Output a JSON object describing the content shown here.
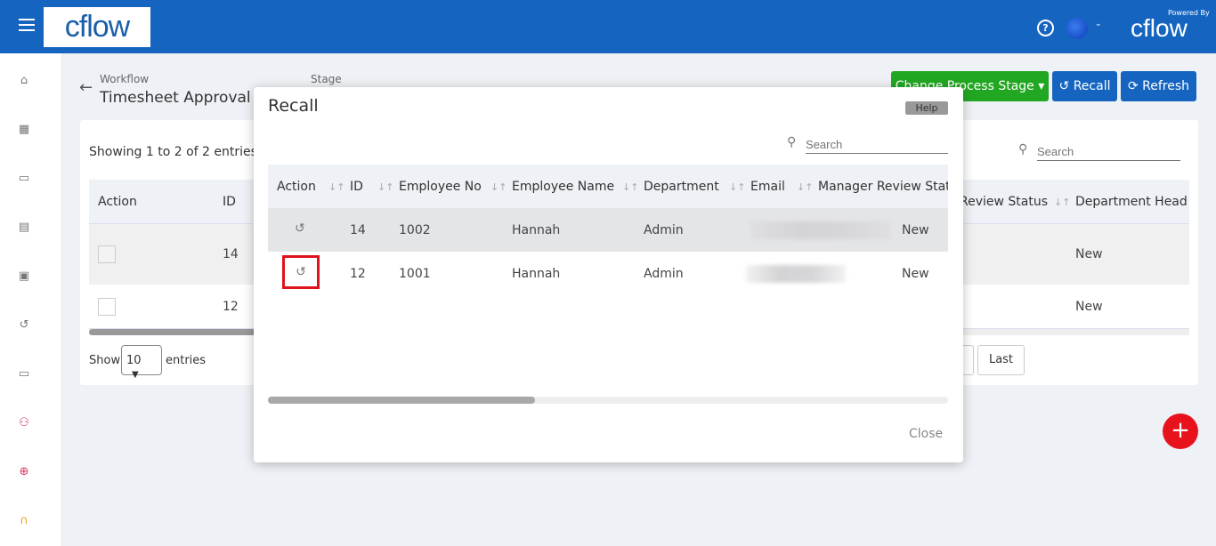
{
  "header": {
    "logo": "cflow",
    "powered_by": "Powered By",
    "brand": "cflow"
  },
  "page": {
    "workflow_label": "Workflow",
    "workflow_name": "Timesheet Approval P",
    "stage_label": "Stage",
    "change_stage": "Change Process Stage",
    "recall": "Recall",
    "refresh": "Refresh"
  },
  "sidebar": [
    "home",
    "dashboard",
    "calendar",
    "reports",
    "documents",
    "history",
    "id-card",
    "org-chart",
    "target",
    "support"
  ],
  "bg_table": {
    "showing": "Showing 1 to 2 of 2 entries",
    "search_placeholder": "Search",
    "col_action": "Action",
    "col_id": "ID",
    "col_review": "Review Status",
    "col_dept_head": "Department Head R",
    "rows": [
      {
        "id": "14",
        "dept_head": "New"
      },
      {
        "id": "12",
        "dept_head": "New"
      }
    ],
    "show": "Show",
    "page_size": "10",
    "entries": "entries",
    "last": "Last"
  },
  "modal": {
    "title": "Recall",
    "help": "Help",
    "search_placeholder": "Search",
    "close": "Close",
    "columns": [
      "Action",
      "ID",
      "Employee No",
      "Employee Name",
      "Department",
      "Email",
      "Manager Review Status"
    ],
    "rows": [
      {
        "id": "14",
        "emp_no": "1002",
        "name": "Hannah",
        "dept": "Admin",
        "status": "New"
      },
      {
        "id": "12",
        "emp_no": "1001",
        "name": "Hannah",
        "dept": "Admin",
        "status": "New"
      }
    ]
  },
  "colors": {
    "primary": "#1565c0",
    "success": "#22a722",
    "fab": "#e8121c",
    "highlight": "#e0121c"
  }
}
